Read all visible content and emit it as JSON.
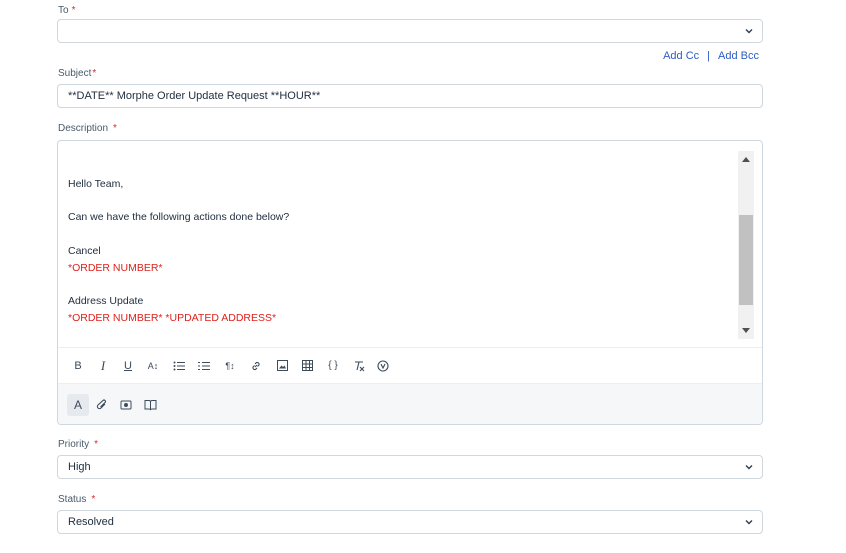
{
  "to": {
    "label": "To",
    "required_mark": "*",
    "value": ""
  },
  "cc_links": {
    "add_cc": "Add Cc",
    "separator": "|",
    "add_bcc": "Add Bcc"
  },
  "subject": {
    "label": "Subject",
    "required_mark": "*",
    "value": "**DATE** Morphe Order Update Request **HOUR**"
  },
  "description": {
    "label": "Description",
    "required_mark": "*",
    "lines": [
      {
        "text": "Hello Team,",
        "color": "#1f2d3d"
      },
      {
        "text": "Can we have the following actions done below?",
        "color": "#1f2d3d"
      },
      {
        "text": "Cancel",
        "color": "#1f2d3d"
      },
      {
        "text": "*ORDER NUMBER*",
        "color": "#e0201b"
      },
      {
        "text": "Address Update",
        "color": "#1f2d3d"
      },
      {
        "text": "*ORDER NUMBER* *UPDATED ADDRESS*",
        "color": "#e0201b"
      }
    ]
  },
  "toolbar": {
    "bold": "B",
    "italic": "I",
    "underline": "U",
    "font_size": "A↕",
    "bullet_list_icon": "bullet-list-icon",
    "numbered_list_icon": "numbered-list-icon",
    "paragraph": "¶↕",
    "link_icon": "link-icon",
    "image_icon": "image-icon",
    "table_icon": "table-icon",
    "code": "{ }",
    "clear_format_icon": "clear-format-icon",
    "canned_response_icon": "canned-response-icon"
  },
  "attach_bar": {
    "text_format": "A",
    "attach_icon": "paperclip-icon",
    "screenshot_icon": "screenshot-icon",
    "solutions_icon": "book-icon"
  },
  "priority": {
    "label": "Priority",
    "required_mark": "*",
    "value": "High"
  },
  "status": {
    "label": "Status",
    "required_mark": "*",
    "value": "Resolved"
  },
  "colors": {
    "link": "#2c5cc5",
    "required": "#d72d30",
    "highlight_text": "#e0201b"
  }
}
